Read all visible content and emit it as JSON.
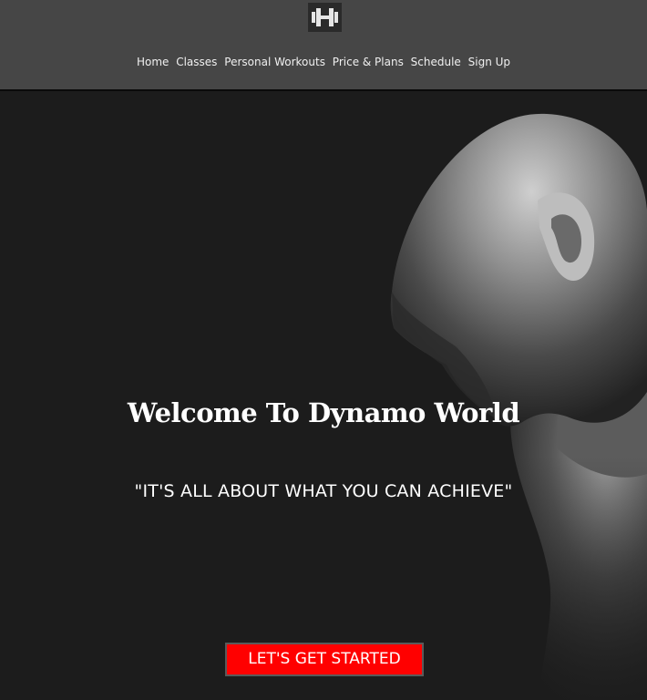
{
  "header": {
    "logo_icon": "dumbbell-icon",
    "nav": [
      {
        "label": "Home"
      },
      {
        "label": "Classes"
      },
      {
        "label": "Personal Workouts"
      },
      {
        "label": "Price & Plans"
      },
      {
        "label": "Schedule"
      },
      {
        "label": "Sign Up"
      }
    ]
  },
  "hero": {
    "title": "Welcome To Dynamo World",
    "quote": "\"IT'S ALL ABOUT WHAT YOU CAN ACHIEVE\"",
    "cta_label": "LET'S GET STARTED"
  },
  "colors": {
    "header_bg": "#464646",
    "hero_bg": "#1c1c1c",
    "cta_bg": "#ff0000",
    "text": "#ffffff"
  }
}
